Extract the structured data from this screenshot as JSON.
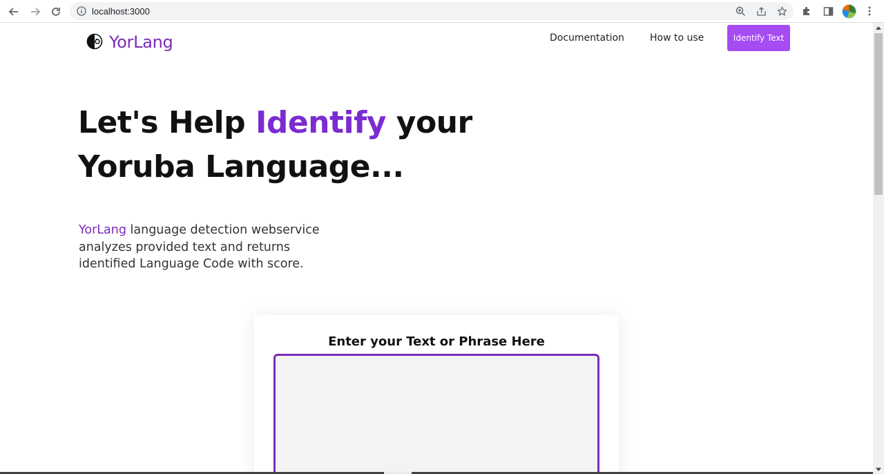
{
  "browser": {
    "url": "localhost:3000"
  },
  "header": {
    "logo_text": "YorLang",
    "nav": [
      {
        "label": "Documentation"
      },
      {
        "label": "How to use"
      }
    ],
    "cta_label": "Identify Text"
  },
  "hero": {
    "headline_part1": "Let's Help ",
    "headline_accent": "Identify",
    "headline_part2": " your",
    "headline_line2": "Yoruba Language...",
    "intro_brand": "YorLang",
    "intro_text": " language detection webservice analyzes provided text and returns identified Language Code with score."
  },
  "identify_card": {
    "title": "Enter your Text or Phrase Here",
    "input_value": ""
  },
  "colors": {
    "brand_purple": "#7b2bb8",
    "cta_purple": "#a64cf2"
  }
}
